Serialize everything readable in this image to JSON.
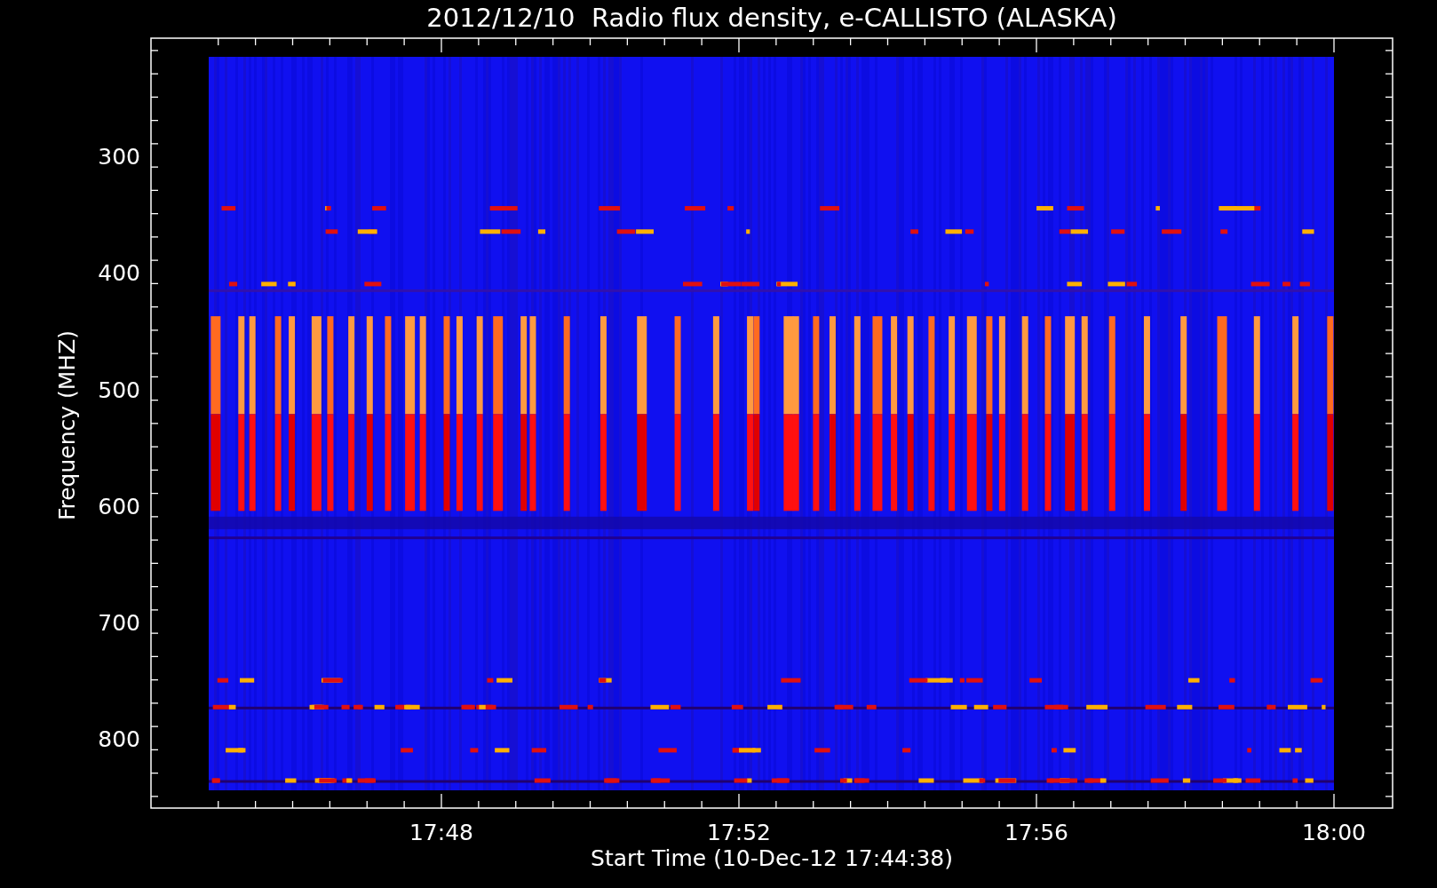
{
  "plot": {
    "title": "2012/12/10  Radio flux density, e-CALLISTO (ALASKA)",
    "y_axis": {
      "label": "Frequency (MHZ)",
      "ticks": [
        "300",
        "400",
        "500",
        "600",
        "700",
        "800"
      ]
    },
    "x_axis": {
      "label": "Start Time (10-Dec-12 17:44:38)",
      "ticks": [
        "17:48",
        "17:52",
        "17:56",
        "18:00"
      ]
    }
  }
}
